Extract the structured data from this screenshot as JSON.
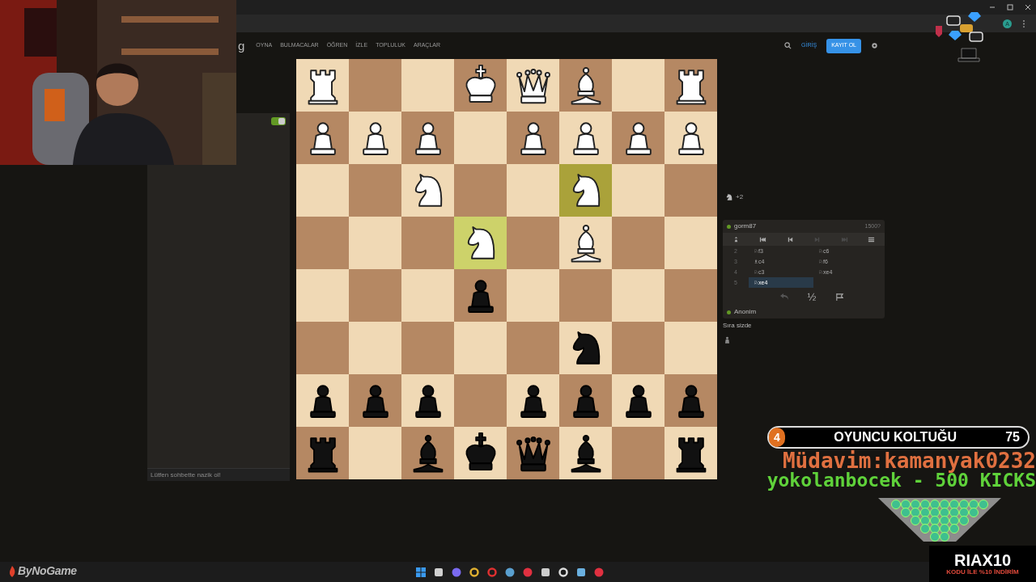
{
  "browser": {
    "profile_initial": "A"
  },
  "nav": {
    "logo": "g",
    "items": [
      "OYNA",
      "BULMACALAR",
      "ÖĞREN",
      "İZLE",
      "TOPLULUK",
      "ARAÇLAR"
    ],
    "login": "GİRİŞ",
    "signup": "KAYIT OL"
  },
  "chat": {
    "enabled": true,
    "placeholder": "Lütfen sohbette nazik ol!"
  },
  "board": {
    "rows": [
      {
        "squares": [
          {
            "kind": "rook",
            "white": true,
            "highlighted": false
          },
          {
            "kind": "empty",
            "highlighted": false
          },
          {
            "kind": "empty",
            "highlighted": false
          },
          {
            "kind": "king",
            "white": true,
            "highlighted": false
          },
          {
            "kind": "queen",
            "white": true,
            "highlighted": false
          },
          {
            "kind": "bishop",
            "white": true,
            "highlighted": false
          },
          {
            "kind": "empty",
            "highlighted": false
          },
          {
            "kind": "rook",
            "white": true,
            "highlighted": false
          }
        ]
      },
      {
        "squares": [
          {
            "kind": "pawn",
            "white": true,
            "highlighted": false
          },
          {
            "kind": "pawn",
            "white": true,
            "highlighted": false
          },
          {
            "kind": "pawn",
            "white": true,
            "highlighted": false
          },
          {
            "kind": "empty",
            "highlighted": false
          },
          {
            "kind": "pawn",
            "white": true,
            "highlighted": false
          },
          {
            "kind": "pawn",
            "white": true,
            "highlighted": false
          },
          {
            "kind": "pawn",
            "white": true,
            "highlighted": false
          },
          {
            "kind": "pawn",
            "white": true,
            "highlighted": false
          }
        ]
      },
      {
        "squares": [
          {
            "kind": "empty",
            "highlighted": false
          },
          {
            "kind": "empty",
            "highlighted": false
          },
          {
            "kind": "knight",
            "white": true,
            "highlighted": false
          },
          {
            "kind": "empty",
            "highlighted": false
          },
          {
            "kind": "empty",
            "highlighted": false
          },
          {
            "kind": "knight",
            "white": true,
            "highlighted": true
          },
          {
            "kind": "empty",
            "highlighted": false
          },
          {
            "kind": "empty",
            "highlighted": false
          }
        ]
      },
      {
        "squares": [
          {
            "kind": "empty",
            "highlighted": false
          },
          {
            "kind": "empty",
            "highlighted": false
          },
          {
            "kind": "empty",
            "highlighted": false
          },
          {
            "kind": "knight",
            "white": true,
            "highlighted": true
          },
          {
            "kind": "empty",
            "highlighted": false
          },
          {
            "kind": "bishop",
            "white": true,
            "highlighted": false
          },
          {
            "kind": "empty",
            "highlighted": false
          },
          {
            "kind": "empty",
            "highlighted": false
          }
        ]
      },
      {
        "squares": [
          {
            "kind": "empty",
            "highlighted": false
          },
          {
            "kind": "empty",
            "highlighted": false
          },
          {
            "kind": "empty",
            "highlighted": false
          },
          {
            "kind": "pawn",
            "white": false,
            "highlighted": false
          },
          {
            "kind": "empty",
            "highlighted": false
          },
          {
            "kind": "empty",
            "highlighted": false
          },
          {
            "kind": "empty",
            "highlighted": false
          },
          {
            "kind": "empty",
            "highlighted": false
          }
        ]
      },
      {
        "squares": [
          {
            "kind": "empty",
            "highlighted": false
          },
          {
            "kind": "empty",
            "highlighted": false
          },
          {
            "kind": "empty",
            "highlighted": false
          },
          {
            "kind": "empty",
            "highlighted": false
          },
          {
            "kind": "empty",
            "highlighted": false
          },
          {
            "kind": "knight",
            "white": false,
            "highlighted": false
          },
          {
            "kind": "empty",
            "highlighted": false
          },
          {
            "kind": "empty",
            "highlighted": false
          }
        ]
      },
      {
        "squares": [
          {
            "kind": "pawn",
            "white": false,
            "highlighted": false
          },
          {
            "kind": "pawn",
            "white": false,
            "highlighted": false
          },
          {
            "kind": "pawn",
            "white": false,
            "highlighted": false
          },
          {
            "kind": "empty",
            "highlighted": false
          },
          {
            "kind": "pawn",
            "white": false,
            "highlighted": false
          },
          {
            "kind": "pawn",
            "white": false,
            "highlighted": false
          },
          {
            "kind": "pawn",
            "white": false,
            "highlighted": false
          },
          {
            "kind": "pawn",
            "white": false,
            "highlighted": false
          }
        ]
      },
      {
        "squares": [
          {
            "kind": "rook",
            "white": false,
            "highlighted": false
          },
          {
            "kind": "empty",
            "highlighted": false
          },
          {
            "kind": "bishop",
            "white": false,
            "highlighted": false
          },
          {
            "kind": "king",
            "white": false,
            "highlighted": false
          },
          {
            "kind": "queen",
            "white": false,
            "highlighted": false
          },
          {
            "kind": "bishop",
            "white": false,
            "highlighted": false
          },
          {
            "kind": "empty",
            "highlighted": false
          },
          {
            "kind": "rook",
            "white": false,
            "highlighted": false
          }
        ]
      }
    ]
  },
  "game": {
    "captured": "+2",
    "opponent": {
      "name": "gorm87",
      "rating": "1500?",
      "online": true
    },
    "toolbar": [
      {
        "kind": "flip",
        "disabled": false
      },
      {
        "kind": "first",
        "disabled": false
      },
      {
        "kind": "prev",
        "disabled": false
      },
      {
        "kind": "next",
        "disabled": true
      },
      {
        "kind": "last",
        "disabled": true
      },
      {
        "kind": "menu",
        "disabled": false
      }
    ],
    "moves": [
      {
        "number": "2",
        "plies": [
          {
            "san": "♘f3",
            "selected": false
          },
          {
            "san": "♘c6",
            "selected": false
          }
        ]
      },
      {
        "number": "3",
        "plies": [
          {
            "san": "♗c4",
            "selected": false
          },
          {
            "san": "♘f6",
            "selected": false
          }
        ]
      },
      {
        "number": "4",
        "plies": [
          {
            "san": "♘c3",
            "selected": false
          },
          {
            "san": "♘xe4",
            "selected": false
          }
        ]
      },
      {
        "number": "5",
        "plies": [
          {
            "san": "♘xe4",
            "selected": true
          }
        ]
      }
    ],
    "controls": [
      {
        "kind": "takeback",
        "disabled": true
      },
      {
        "kind": "draw",
        "label": "½",
        "disabled": false
      },
      {
        "kind": "resign",
        "disabled": false
      }
    ],
    "player": {
      "name": "Anonim",
      "online": true
    },
    "turn_text": "Sıra sizde"
  },
  "overlay": {
    "goal": {
      "rank": "4",
      "title": "OYUNCU KOLTUĞU",
      "count": "75"
    },
    "regular": "Müdavim:kamanyak0232",
    "ticker": "yokolanbocek - 500 KICKS",
    "sponsor": {
      "code": "RIAX10",
      "subtitle": "KODU İLE %10 İNDİRİM"
    },
    "streamer_logo": "ByNoGame"
  }
}
